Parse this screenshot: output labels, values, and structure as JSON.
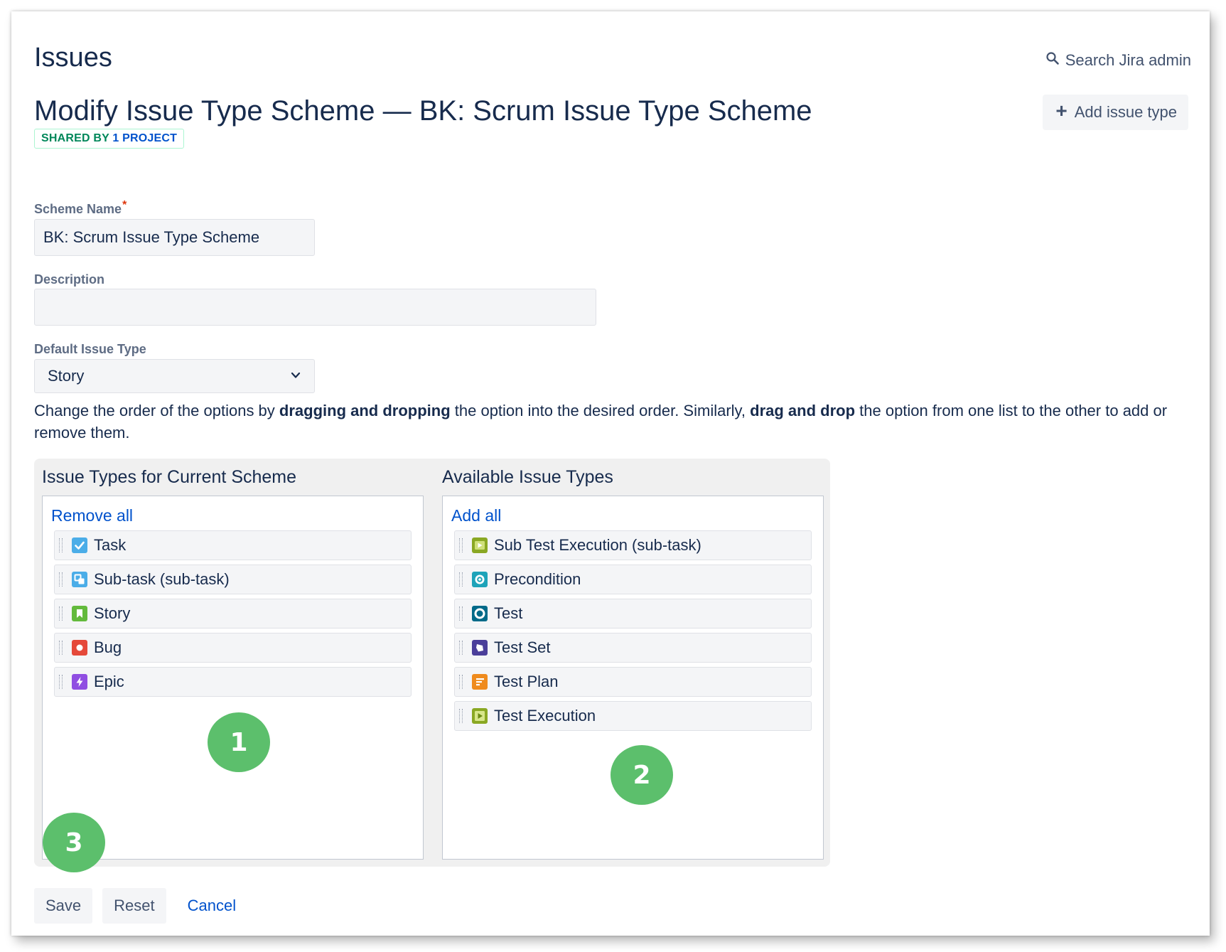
{
  "header": {
    "title": "Issues",
    "search_label": "Search Jira admin"
  },
  "scheme": {
    "title": "Modify Issue Type Scheme — BK: Scrum Issue Type Scheme",
    "badge_prefix": "SHARED BY",
    "badge_link": "1 PROJECT",
    "add_issue_type_label": "Add issue type"
  },
  "form": {
    "scheme_name_label": "Scheme Name",
    "scheme_name_required": "*",
    "scheme_name_value": "BK: Scrum Issue Type Scheme",
    "description_label": "Description",
    "description_value": "",
    "default_issue_type_label": "Default Issue Type",
    "default_issue_type_value": "Story"
  },
  "help": {
    "part1": "Change the order of the options by ",
    "bold1": "dragging and dropping",
    "part2": " the option into the desired order. Similarly, ",
    "bold2": "drag and drop",
    "part3": " the option from one list to the other to add or remove them."
  },
  "current_scheme": {
    "title": "Issue Types for Current Scheme",
    "action": "Remove all",
    "items": [
      {
        "label": "Task",
        "icon": "task-icon",
        "color": "#4bade8"
      },
      {
        "label": "Sub-task (sub-task)",
        "icon": "subtask-icon",
        "color": "#4bade8"
      },
      {
        "label": "Story",
        "icon": "story-icon",
        "color": "#63ba3c"
      },
      {
        "label": "Bug",
        "icon": "bug-icon",
        "color": "#e5493a"
      },
      {
        "label": "Epic",
        "icon": "epic-icon",
        "color": "#904ee2"
      }
    ]
  },
  "available": {
    "title": "Available Issue Types",
    "action": "Add all",
    "items": [
      {
        "label": "Sub Test Execution (sub-task)",
        "icon": "sub-test-execution-icon",
        "color": "#8aa823"
      },
      {
        "label": "Precondition",
        "icon": "precondition-icon",
        "color": "#1ea3b9"
      },
      {
        "label": "Test",
        "icon": "test-icon",
        "color": "#006a89"
      },
      {
        "label": "Test Set",
        "icon": "test-set-icon",
        "color": "#4b3f9a"
      },
      {
        "label": "Test Plan",
        "icon": "test-plan-icon",
        "color": "#ef8b1d"
      },
      {
        "label": "Test Execution",
        "icon": "test-execution-icon",
        "color": "#8aa823"
      }
    ]
  },
  "markers": [
    "1",
    "2",
    "3"
  ],
  "buttons": {
    "save": "Save",
    "reset": "Reset",
    "cancel": "Cancel"
  }
}
